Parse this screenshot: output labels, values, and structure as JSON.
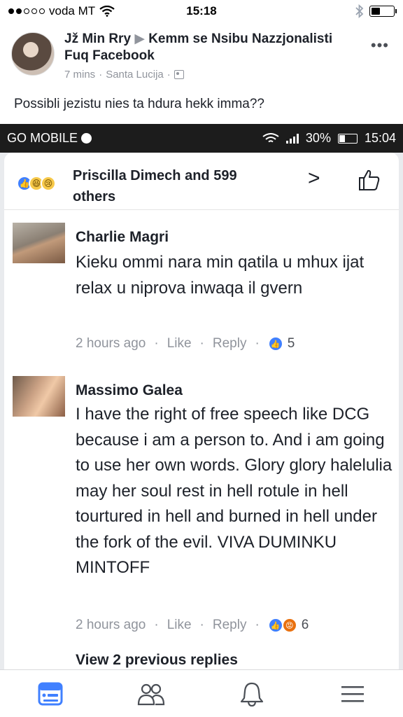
{
  "status_bar": {
    "carrier": "voda MT",
    "time": "15:18"
  },
  "post": {
    "author": "Jž Min Rry",
    "target": "Kemm se Nsibu Nazzjonalisti Fuq Facebook",
    "time": "7 mins",
    "location": "Santa Lucija",
    "text": "Possibli jezistu nies ta hdura hekk imma??"
  },
  "screenshot": {
    "status": {
      "go_mobile": "GO MOBILE",
      "battery": "30%",
      "time": "15:04"
    },
    "reactions_text": "Priscilla Dimech and 599 others",
    "comments": [
      {
        "name": "Charlie Magri",
        "body": "Kieku ommi nara min qatila u mhux ijat relax u niprova inwaqa il gvern",
        "time": "2 hours ago",
        "like": "Like",
        "reply": "Reply",
        "count": "5"
      },
      {
        "name": "Massimo Galea",
        "body": "I have the right of free speech like DCG because i am a person to. And i am going to use her own words. Glory glory halelulia may her soul rest in hell rotule in hell tourtured in hell and burned in hell under the fork of the evil. VIVA DUMINKU MINTOFF",
        "time": "2 hours ago",
        "like": "Like",
        "reply": "Reply",
        "count": "6"
      }
    ],
    "view_previous": "View 2 previous replies"
  },
  "colors": {
    "facebook_blue": "#4080ff",
    "meta_gray": "#90949c",
    "angry_orange": "#e9710f"
  },
  "icons": {
    "tabs": [
      "news-feed-icon",
      "friends-icon",
      "notifications-bell-icon",
      "menu-icon"
    ]
  }
}
